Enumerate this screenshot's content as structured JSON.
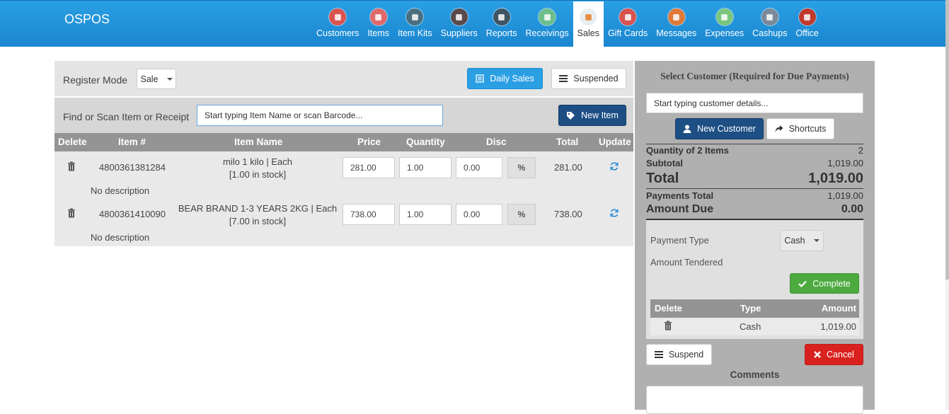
{
  "brand": "OSPOS",
  "nav": [
    {
      "label": "Customers",
      "color": "#d9534f",
      "icon": "customers-icon"
    },
    {
      "label": "Items",
      "color": "#e06a6a",
      "icon": "items-icon"
    },
    {
      "label": "Item Kits",
      "color": "#4a6f7e",
      "icon": "item-kits-icon"
    },
    {
      "label": "Suppliers",
      "color": "#5a4a4a",
      "icon": "suppliers-icon"
    },
    {
      "label": "Reports",
      "color": "#3f5563",
      "icon": "reports-icon"
    },
    {
      "label": "Receivings",
      "color": "#6dbf8a",
      "icon": "receivings-icon"
    },
    {
      "label": "Sales",
      "color": "#e8eef2",
      "icon": "sales-icon",
      "active": true
    },
    {
      "label": "Gift Cards",
      "color": "#d9534f",
      "icon": "gift-cards-icon"
    },
    {
      "label": "Messages",
      "color": "#e07a3a",
      "icon": "messages-icon"
    },
    {
      "label": "Expenses",
      "color": "#7bc67e",
      "icon": "expenses-icon"
    },
    {
      "label": "Cashups",
      "color": "#7a8a9a",
      "icon": "cashups-icon"
    },
    {
      "label": "Office",
      "color": "#c0392b",
      "icon": "office-icon"
    }
  ],
  "register": {
    "mode_label": "Register Mode",
    "mode_value": "Sale",
    "daily_sales": "Daily Sales",
    "suspended": "Suspended"
  },
  "find": {
    "label": "Find or Scan Item or Receipt",
    "placeholder": "Start typing Item Name or scan Barcode...",
    "new_item": "New Item"
  },
  "table": {
    "headers": [
      "Delete",
      "Item #",
      "Item Name",
      "Price",
      "Quantity",
      "Disc",
      "Total",
      "Update"
    ],
    "rows": [
      {
        "item_no": "4800361381284",
        "name": "milo 1 kilo | Each",
        "stock": "[1.00 in stock]",
        "price": "281.00",
        "qty": "1.00",
        "disc": "0.00",
        "disc_type": "%",
        "total": "281.00",
        "description": "No description"
      },
      {
        "item_no": "4800361410090",
        "name": "BEAR BRAND 1-3 YEARS 2KG | Each",
        "stock": "[7.00 in stock]",
        "price": "738.00",
        "qty": "1.00",
        "disc": "0.00",
        "disc_type": "%",
        "total": "738.00",
        "description": "No description"
      }
    ]
  },
  "customer": {
    "title": "Select Customer (Required for Due Payments)",
    "placeholder": "Start typing customer details...",
    "new_customer": "New Customer",
    "shortcuts": "Shortcuts"
  },
  "summary": {
    "qty_label": "Quantity of 2 Items",
    "qty_value": "2",
    "subtotal_label": "Subtotal",
    "subtotal_value": "1,019.00",
    "total_label": "Total",
    "total_value": "1,019.00",
    "payments_label": "Payments Total",
    "payments_value": "1,019.00",
    "due_label": "Amount Due",
    "due_value": "0.00"
  },
  "payment": {
    "type_label": "Payment Type",
    "type_value": "Cash",
    "tendered_label": "Amount Tendered",
    "complete": "Complete",
    "headers": [
      "Delete",
      "Type",
      "Amount"
    ],
    "rows": [
      {
        "type": "Cash",
        "amount": "1,019.00"
      }
    ]
  },
  "actions": {
    "suspend": "Suspend",
    "cancel": "Cancel",
    "comments": "Comments"
  }
}
